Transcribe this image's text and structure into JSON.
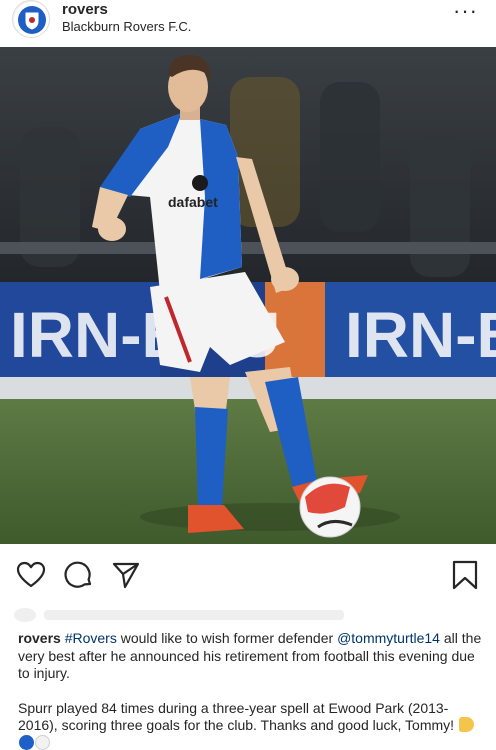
{
  "post": {
    "username": "rovers",
    "account_name": "Blackburn Rovers F.C.",
    "more_icon": "···"
  },
  "photo": {
    "shirt_sponsor": "dafabet",
    "board_text": "IRN-BRU"
  },
  "actions": {
    "like_icon": "heart-icon",
    "comment_icon": "comment-icon",
    "share_icon": "paper-plane-icon",
    "save_icon": "bookmark-icon"
  },
  "caption": {
    "username": "rovers",
    "hashtag": "#Rovers",
    "text_1": " would like to wish former defender ",
    "mention": "@tommyturtle14",
    "text_2": " all the very best after he announced his retirement from football this evening due to injury.",
    "paragraph_2": "Spurr played 84 times during a three-year spell at Ewood Park (2013-2016), scoring three goals for the club. Thanks and good luck, Tommy! "
  },
  "colors": {
    "link": "#003569",
    "kit_blue": "#1f5fc4"
  }
}
